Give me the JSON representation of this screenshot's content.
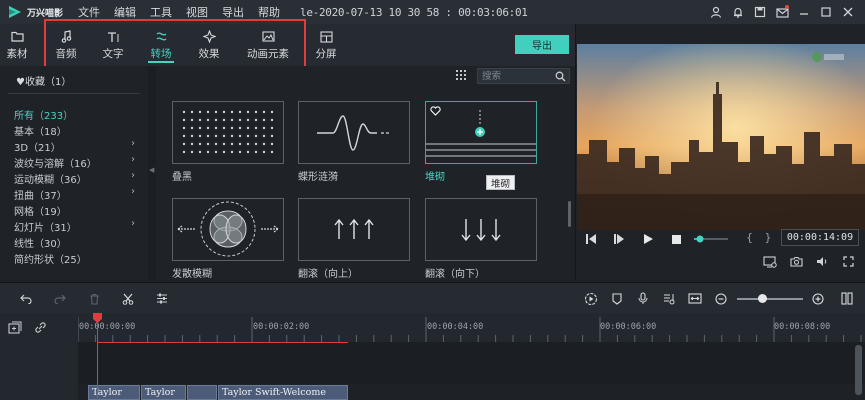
{
  "app": {
    "logo_text": "万兴喵影",
    "menus": [
      "文件",
      "编辑",
      "工具",
      "视图",
      "导出",
      "帮助"
    ],
    "project_title": "le-2020-07-13 10 30 58 : 00:03:06:01"
  },
  "toolbar": {
    "tabs": [
      {
        "label": "素材",
        "icon": "folder-icon"
      },
      {
        "label": "音频",
        "icon": "music-note-icon"
      },
      {
        "label": "文字",
        "icon": "text-icon"
      },
      {
        "label": "转场",
        "icon": "transition-icon",
        "active": true
      },
      {
        "label": "效果",
        "icon": "effects-icon"
      },
      {
        "label": "动画元素",
        "icon": "image-icon"
      },
      {
        "label": "分屏",
        "icon": "split-screen-icon"
      }
    ],
    "export_label": "导出"
  },
  "sidebar": {
    "favorites": "♥收藏（1）",
    "categories": [
      {
        "label": "所有（233）",
        "active": true
      },
      {
        "label": "基本（18）"
      },
      {
        "label": "3D（21）",
        "expandable": true
      },
      {
        "label": "波纹与溶解（16）",
        "expandable": true
      },
      {
        "label": "运动模糊（36）",
        "expandable": true
      },
      {
        "label": "扭曲（37）",
        "expandable": true
      },
      {
        "label": "网格（19）"
      },
      {
        "label": "幻灯片（31）",
        "expandable": true
      },
      {
        "label": "线性（30）"
      },
      {
        "label": "简约形状（25）"
      }
    ]
  },
  "grid": {
    "search_placeholder": "搜索",
    "items": [
      {
        "label": "叠黑"
      },
      {
        "label": "蝶形涟漪"
      },
      {
        "label": "堆砌",
        "selected": true
      },
      {
        "label": "发散模糊"
      },
      {
        "label": "翻滚（向上）"
      },
      {
        "label": "翻滚（向下）"
      }
    ],
    "tooltip": "堆砌"
  },
  "preview": {
    "timecode": "00:00:14:09",
    "braces": "{ }"
  },
  "timeline": {
    "ruler_labels": [
      "00:00:00:00",
      "00:00:02:00",
      "00:00:04:00",
      "00:00:06:00",
      "00:00:08:00"
    ],
    "clips": [
      "Taylor",
      "Taylor",
      "",
      "Taylor Swift-Welcome"
    ]
  },
  "colors": {
    "accent": "#47d3c2",
    "highlight_red": "#e03c3c",
    "clip_blue": "#4c5b78"
  }
}
